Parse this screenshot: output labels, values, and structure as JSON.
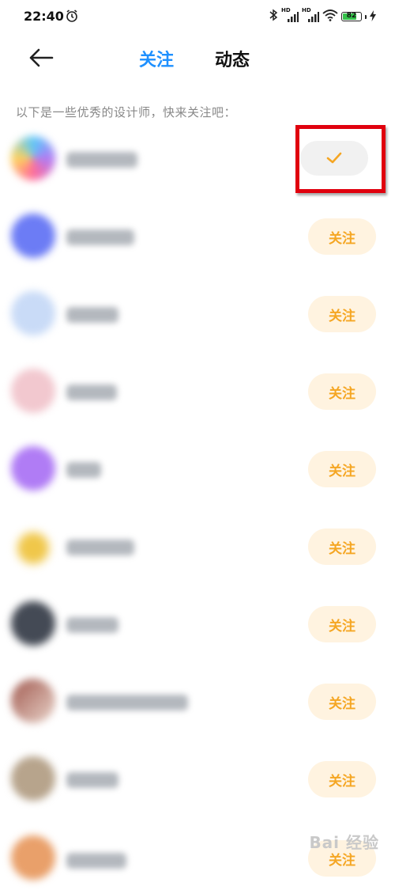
{
  "status_bar": {
    "time": "22:40",
    "hd1": "HD",
    "hd2": "HD",
    "battery": "82"
  },
  "header": {
    "tabs": [
      {
        "label": "关注",
        "active": true,
        "color": "#1e90ff"
      },
      {
        "label": "动态",
        "active": false,
        "color": "#111111"
      }
    ]
  },
  "section_hint": "以下是一些优秀的设计师，快来关注吧：",
  "follow_label": "关注",
  "designers": [
    {
      "followed": true,
      "avatar_color": "#e58ab6"
    },
    {
      "followed": false,
      "avatar_color": "#6c7cf5"
    },
    {
      "followed": false,
      "avatar_color": "#c9dbf7"
    },
    {
      "followed": false,
      "avatar_color": "#f2c8cf"
    },
    {
      "followed": false,
      "avatar_color": "#b07cf5"
    },
    {
      "followed": false,
      "avatar_color": "#f0c74a"
    },
    {
      "followed": false,
      "avatar_color": "#444a55"
    },
    {
      "followed": false,
      "avatar_color": "#c9978f"
    },
    {
      "followed": false,
      "avatar_color": "#b7a48c"
    },
    {
      "followed": false,
      "avatar_color": "#e9a06a"
    }
  ],
  "colors": {
    "accent": "#1e90ff",
    "follow_text": "#f5a623",
    "follow_bg": "#fff3e0",
    "highlight": "#e0000e"
  },
  "watermark": "Bai 经验"
}
